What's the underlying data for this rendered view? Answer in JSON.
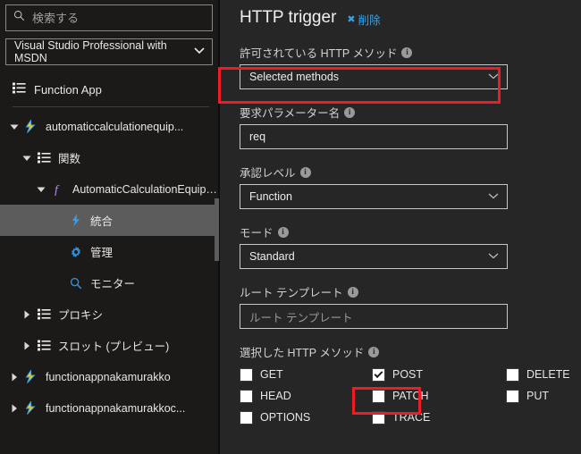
{
  "sidebar": {
    "search": {
      "placeholder": "検索する",
      "value": "",
      "icon": "search-icon"
    },
    "subscription": {
      "label": "Visual Studio Professional with MSDN",
      "icon": "chevron-down-icon"
    },
    "app_header": {
      "label": "Function App",
      "icon": "list-icon"
    },
    "tree": [
      {
        "label": "automaticcalculationequip...",
        "icon": "function-app-icon",
        "twisty": "expanded",
        "indent": 0,
        "selected": false
      },
      {
        "label": "関数",
        "icon": "list-icon",
        "twisty": "expanded",
        "indent": 1,
        "selected": false
      },
      {
        "label": "AutomaticCalculationEquipment",
        "icon": "function-f-icon",
        "twisty": "expanded",
        "indent": 2,
        "selected": false
      },
      {
        "label": "統合",
        "icon": "bolt-icon",
        "twisty": "none",
        "indent": 3,
        "selected": true
      },
      {
        "label": "管理",
        "icon": "gear-icon",
        "twisty": "none",
        "indent": 3,
        "selected": false
      },
      {
        "label": "モニター",
        "icon": "search-icon",
        "twisty": "none",
        "indent": 3,
        "selected": false
      },
      {
        "label": "プロキシ",
        "icon": "list-icon",
        "twisty": "collapsed",
        "indent": 1,
        "selected": false
      },
      {
        "label": "スロット (プレビュー)",
        "icon": "list-icon",
        "twisty": "collapsed",
        "indent": 1,
        "selected": false
      },
      {
        "label": "functionappnakamurakko",
        "icon": "function-app-icon",
        "twisty": "collapsed",
        "indent": 0,
        "selected": false
      },
      {
        "label": "functionappnakamurakkoc...",
        "icon": "function-app-icon",
        "twisty": "collapsed",
        "indent": 0,
        "selected": false
      }
    ]
  },
  "main": {
    "title": "HTTP trigger",
    "delete_label": "削除",
    "delete_icon": "close-x-icon",
    "fields": {
      "allowed_methods": {
        "label": "許可されている HTTP メソッド",
        "value": "Selected methods",
        "type": "select",
        "highlighted": true
      },
      "request_parameter_name": {
        "label": "要求パラメーター名",
        "value": "req",
        "type": "text",
        "highlighted": false
      },
      "auth_level": {
        "label": "承認レベル",
        "value": "Function",
        "type": "select",
        "highlighted": false
      },
      "mode": {
        "label": "モード",
        "value": "Standard",
        "type": "select",
        "highlighted": false
      },
      "route_template": {
        "label": "ルート テンプレート",
        "value": "",
        "placeholder": "ルート テンプレート",
        "type": "text",
        "highlighted": false
      }
    },
    "selected_methods": {
      "label": "選択した HTTP メソッド",
      "columns": [
        [
          {
            "label": "GET",
            "checked": false,
            "highlighted": false
          },
          {
            "label": "HEAD",
            "checked": false,
            "highlighted": false
          },
          {
            "label": "OPTIONS",
            "checked": false,
            "highlighted": false
          }
        ],
        [
          {
            "label": "POST",
            "checked": true,
            "highlighted": true
          },
          {
            "label": "PATCH",
            "checked": false,
            "highlighted": false
          },
          {
            "label": "TRACE",
            "checked": false,
            "highlighted": false
          }
        ],
        [
          {
            "label": "DELETE",
            "checked": false,
            "highlighted": false
          },
          {
            "label": "PUT",
            "checked": false,
            "highlighted": false
          }
        ]
      ]
    }
  },
  "colors": {
    "sidebar_bg": "#1b1a19",
    "main_bg": "#262626",
    "accent_blue": "#3aa0e3",
    "highlight_red": "#ee1c25",
    "selected_row": "#5c5c5c",
    "bolt_yellow": "#f2c811"
  }
}
